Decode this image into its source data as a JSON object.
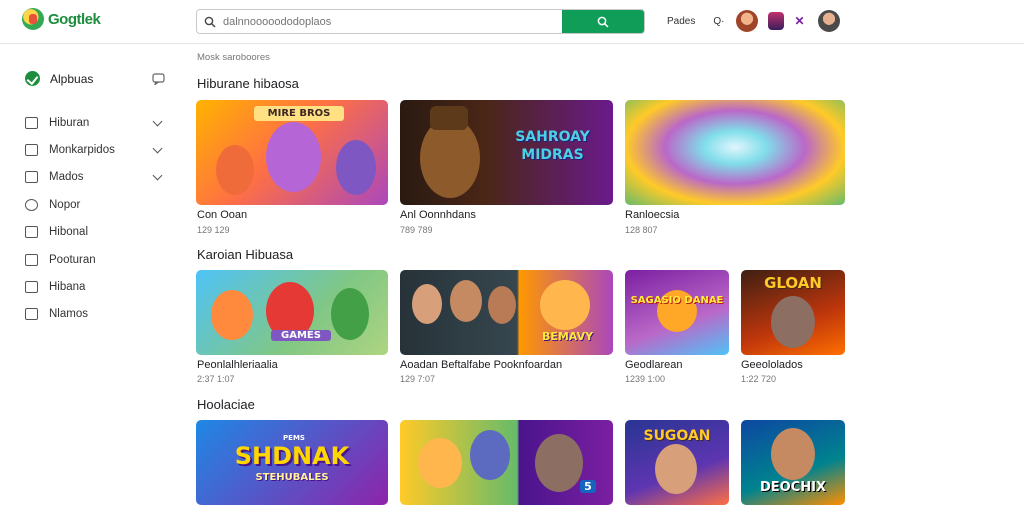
{
  "header": {
    "logo_text": "Gogtlek",
    "search_placeholder": "dalnnooooododoplaos",
    "link_label": "Pades",
    "dropdown_label": "Q·"
  },
  "sidebar": {
    "head": {
      "label": "Alpbuas"
    },
    "items": [
      {
        "label": "Hiburan",
        "has_chevron": true
      },
      {
        "label": "Monkarpidos",
        "has_chevron": true
      },
      {
        "label": "Mados",
        "has_chevron": true
      },
      {
        "label": "Nopor",
        "has_chevron": false
      },
      {
        "label": "Hibonal",
        "has_chevron": false
      },
      {
        "label": "Pooturan",
        "has_chevron": false
      },
      {
        "label": "Hibana",
        "has_chevron": false
      },
      {
        "label": "Nlamos",
        "has_chevron": false
      }
    ]
  },
  "main": {
    "breadcrumb": "Mosk saroboores",
    "sections": [
      {
        "title": "Hiburane hibaosa",
        "cards": [
          {
            "title": "Con Ooan",
            "meta": "129 129",
            "art": "MIRE BROS"
          },
          {
            "title": "Anl Oonnhdans",
            "meta": "789 789",
            "art": "SAHROAY MIDRAS"
          },
          {
            "title": "Ranloecsia",
            "meta": "128 807",
            "art": ""
          }
        ]
      },
      {
        "title": "Karoian Hibuasa",
        "cards": [
          {
            "title": "Peonlalhleriaalia",
            "meta": "2:37 1:07",
            "art": "GAMES"
          },
          {
            "title": "Aoadan Beftalfabe  Pooknfoardan",
            "meta": "129 7:07",
            "art": "BEMAVY"
          },
          {
            "title": "Geodlarean",
            "meta": "1239 1:00",
            "art": "SAGASIO DANAE"
          },
          {
            "title": "Geeololados",
            "meta": "1:22 720",
            "art": "GLOAN"
          }
        ]
      },
      {
        "title": "Hoolaciae",
        "cards": [
          {
            "title": "",
            "meta": "",
            "art": "SHDNAK",
            "art2": "STEHUBALES",
            "art3": "PEMS"
          },
          {
            "title": "",
            "meta": "",
            "art": "5"
          },
          {
            "title": "",
            "meta": "",
            "art": "SUGOAN"
          },
          {
            "title": "",
            "meta": "",
            "art": "DEOCHIX"
          }
        ]
      }
    ]
  },
  "colors": {
    "brand": "#1e8e3e",
    "search_button": "#0f9d58"
  }
}
